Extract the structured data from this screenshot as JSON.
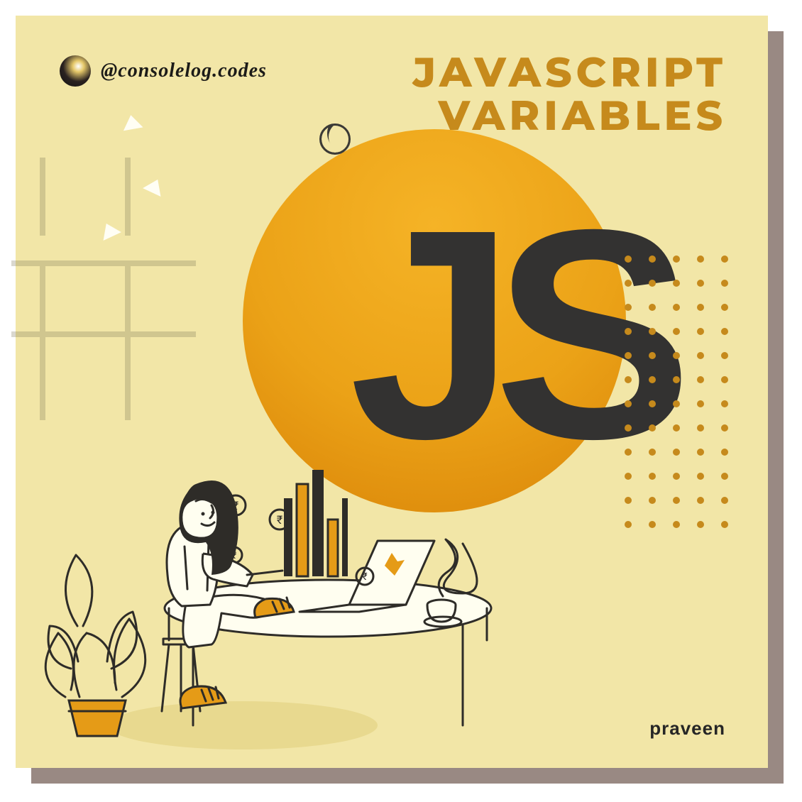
{
  "handle": {
    "text": "@consolelog.codes"
  },
  "title": {
    "line1": "JAVASCRIPT",
    "line2": "VARIABLES"
  },
  "logo": {
    "text": "JS"
  },
  "author": {
    "name": "praveen"
  },
  "colors": {
    "background": "#f2e6a7",
    "accent": "#c68a1c",
    "circle_top": "#f5b326",
    "circle_bottom": "#d98408",
    "dark": "#333231"
  }
}
